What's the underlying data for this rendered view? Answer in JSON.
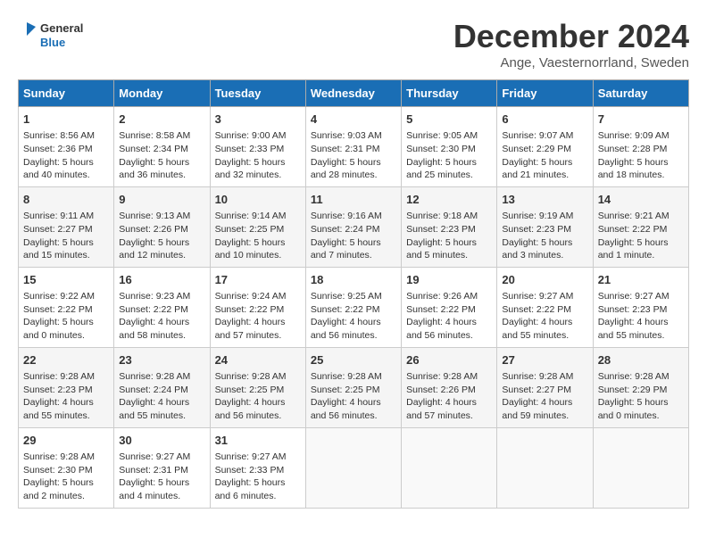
{
  "header": {
    "logo_line1": "General",
    "logo_line2": "Blue",
    "month": "December 2024",
    "location": "Ange, Vaesternorrland, Sweden"
  },
  "days_of_week": [
    "Sunday",
    "Monday",
    "Tuesday",
    "Wednesday",
    "Thursday",
    "Friday",
    "Saturday"
  ],
  "weeks": [
    [
      {
        "day": 1,
        "lines": [
          "Sunrise: 8:56 AM",
          "Sunset: 2:36 PM",
          "Daylight: 5 hours",
          "and 40 minutes."
        ]
      },
      {
        "day": 2,
        "lines": [
          "Sunrise: 8:58 AM",
          "Sunset: 2:34 PM",
          "Daylight: 5 hours",
          "and 36 minutes."
        ]
      },
      {
        "day": 3,
        "lines": [
          "Sunrise: 9:00 AM",
          "Sunset: 2:33 PM",
          "Daylight: 5 hours",
          "and 32 minutes."
        ]
      },
      {
        "day": 4,
        "lines": [
          "Sunrise: 9:03 AM",
          "Sunset: 2:31 PM",
          "Daylight: 5 hours",
          "and 28 minutes."
        ]
      },
      {
        "day": 5,
        "lines": [
          "Sunrise: 9:05 AM",
          "Sunset: 2:30 PM",
          "Daylight: 5 hours",
          "and 25 minutes."
        ]
      },
      {
        "day": 6,
        "lines": [
          "Sunrise: 9:07 AM",
          "Sunset: 2:29 PM",
          "Daylight: 5 hours",
          "and 21 minutes."
        ]
      },
      {
        "day": 7,
        "lines": [
          "Sunrise: 9:09 AM",
          "Sunset: 2:28 PM",
          "Daylight: 5 hours",
          "and 18 minutes."
        ]
      }
    ],
    [
      {
        "day": 8,
        "lines": [
          "Sunrise: 9:11 AM",
          "Sunset: 2:27 PM",
          "Daylight: 5 hours",
          "and 15 minutes."
        ]
      },
      {
        "day": 9,
        "lines": [
          "Sunrise: 9:13 AM",
          "Sunset: 2:26 PM",
          "Daylight: 5 hours",
          "and 12 minutes."
        ]
      },
      {
        "day": 10,
        "lines": [
          "Sunrise: 9:14 AM",
          "Sunset: 2:25 PM",
          "Daylight: 5 hours",
          "and 10 minutes."
        ]
      },
      {
        "day": 11,
        "lines": [
          "Sunrise: 9:16 AM",
          "Sunset: 2:24 PM",
          "Daylight: 5 hours",
          "and 7 minutes."
        ]
      },
      {
        "day": 12,
        "lines": [
          "Sunrise: 9:18 AM",
          "Sunset: 2:23 PM",
          "Daylight: 5 hours",
          "and 5 minutes."
        ]
      },
      {
        "day": 13,
        "lines": [
          "Sunrise: 9:19 AM",
          "Sunset: 2:23 PM",
          "Daylight: 5 hours",
          "and 3 minutes."
        ]
      },
      {
        "day": 14,
        "lines": [
          "Sunrise: 9:21 AM",
          "Sunset: 2:22 PM",
          "Daylight: 5 hours",
          "and 1 minute."
        ]
      }
    ],
    [
      {
        "day": 15,
        "lines": [
          "Sunrise: 9:22 AM",
          "Sunset: 2:22 PM",
          "Daylight: 5 hours",
          "and 0 minutes."
        ]
      },
      {
        "day": 16,
        "lines": [
          "Sunrise: 9:23 AM",
          "Sunset: 2:22 PM",
          "Daylight: 4 hours",
          "and 58 minutes."
        ]
      },
      {
        "day": 17,
        "lines": [
          "Sunrise: 9:24 AM",
          "Sunset: 2:22 PM",
          "Daylight: 4 hours",
          "and 57 minutes."
        ]
      },
      {
        "day": 18,
        "lines": [
          "Sunrise: 9:25 AM",
          "Sunset: 2:22 PM",
          "Daylight: 4 hours",
          "and 56 minutes."
        ]
      },
      {
        "day": 19,
        "lines": [
          "Sunrise: 9:26 AM",
          "Sunset: 2:22 PM",
          "Daylight: 4 hours",
          "and 56 minutes."
        ]
      },
      {
        "day": 20,
        "lines": [
          "Sunrise: 9:27 AM",
          "Sunset: 2:22 PM",
          "Daylight: 4 hours",
          "and 55 minutes."
        ]
      },
      {
        "day": 21,
        "lines": [
          "Sunrise: 9:27 AM",
          "Sunset: 2:23 PM",
          "Daylight: 4 hours",
          "and 55 minutes."
        ]
      }
    ],
    [
      {
        "day": 22,
        "lines": [
          "Sunrise: 9:28 AM",
          "Sunset: 2:23 PM",
          "Daylight: 4 hours",
          "and 55 minutes."
        ]
      },
      {
        "day": 23,
        "lines": [
          "Sunrise: 9:28 AM",
          "Sunset: 2:24 PM",
          "Daylight: 4 hours",
          "and 55 minutes."
        ]
      },
      {
        "day": 24,
        "lines": [
          "Sunrise: 9:28 AM",
          "Sunset: 2:25 PM",
          "Daylight: 4 hours",
          "and 56 minutes."
        ]
      },
      {
        "day": 25,
        "lines": [
          "Sunrise: 9:28 AM",
          "Sunset: 2:25 PM",
          "Daylight: 4 hours",
          "and 56 minutes."
        ]
      },
      {
        "day": 26,
        "lines": [
          "Sunrise: 9:28 AM",
          "Sunset: 2:26 PM",
          "Daylight: 4 hours",
          "and 57 minutes."
        ]
      },
      {
        "day": 27,
        "lines": [
          "Sunrise: 9:28 AM",
          "Sunset: 2:27 PM",
          "Daylight: 4 hours",
          "and 59 minutes."
        ]
      },
      {
        "day": 28,
        "lines": [
          "Sunrise: 9:28 AM",
          "Sunset: 2:29 PM",
          "Daylight: 5 hours",
          "and 0 minutes."
        ]
      }
    ],
    [
      {
        "day": 29,
        "lines": [
          "Sunrise: 9:28 AM",
          "Sunset: 2:30 PM",
          "Daylight: 5 hours",
          "and 2 minutes."
        ]
      },
      {
        "day": 30,
        "lines": [
          "Sunrise: 9:27 AM",
          "Sunset: 2:31 PM",
          "Daylight: 5 hours",
          "and 4 minutes."
        ]
      },
      {
        "day": 31,
        "lines": [
          "Sunrise: 9:27 AM",
          "Sunset: 2:33 PM",
          "Daylight: 5 hours",
          "and 6 minutes."
        ]
      },
      null,
      null,
      null,
      null
    ]
  ]
}
